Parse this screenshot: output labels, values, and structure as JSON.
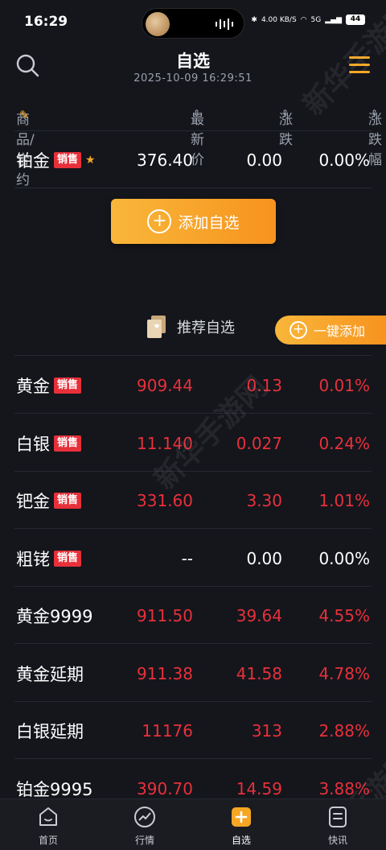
{
  "status_bar": {
    "time": "16:29",
    "speed": "4.00 KB/S",
    "network": "5G",
    "battery": "44"
  },
  "header": {
    "title": "自选",
    "datetime": "2025-10-09 16:29:51"
  },
  "columns": {
    "product": "商品/合约",
    "price": "最新价",
    "change": "涨跌",
    "change_pct": "涨跌幅"
  },
  "watchlist": [
    {
      "name": "铂金",
      "badge": "销售",
      "starred": true,
      "price": "376.40",
      "change": "0.00",
      "change_pct": "0.00%",
      "color": "#ffffff"
    }
  ],
  "add_button": {
    "label": "添加自选"
  },
  "recommend": {
    "title": "推荐自选",
    "one_click_add": "一键添加"
  },
  "recommended": [
    {
      "name": "黄金",
      "badge": "销售",
      "price": "909.44",
      "change": "0.13",
      "change_pct": "0.01%",
      "color": "#e8303a"
    },
    {
      "name": "白银",
      "badge": "销售",
      "price": "11.140",
      "change": "0.027",
      "change_pct": "0.24%",
      "color": "#e8303a"
    },
    {
      "name": "钯金",
      "badge": "销售",
      "price": "331.60",
      "change": "3.30",
      "change_pct": "1.01%",
      "color": "#e8303a"
    },
    {
      "name": "粗铑",
      "badge": "销售",
      "price": "--",
      "change": "0.00",
      "change_pct": "0.00%",
      "color": "#ffffff"
    },
    {
      "name": "黄金9999",
      "badge": "",
      "price": "911.50",
      "change": "39.64",
      "change_pct": "4.55%",
      "color": "#e8303a"
    },
    {
      "name": "黄金延期",
      "badge": "",
      "price": "911.38",
      "change": "41.58",
      "change_pct": "4.78%",
      "color": "#e8303a"
    },
    {
      "name": "白银延期",
      "badge": "",
      "price": "11176",
      "change": "313",
      "change_pct": "2.88%",
      "color": "#e8303a"
    },
    {
      "name": "铂金9995",
      "badge": "",
      "price": "390.70",
      "change": "14.59",
      "change_pct": "3.88%",
      "color": "#e8303a"
    }
  ],
  "nav": [
    {
      "label": "首页",
      "icon": "home-icon"
    },
    {
      "label": "行情",
      "icon": "trend-icon"
    },
    {
      "label": "自选",
      "icon": "add-square-icon",
      "active": true
    },
    {
      "label": "快讯",
      "icon": "news-icon"
    }
  ],
  "watermark": "新华手游网",
  "colors": {
    "accent": "#f5a623",
    "up": "#e8303a",
    "background": "#14161c"
  }
}
